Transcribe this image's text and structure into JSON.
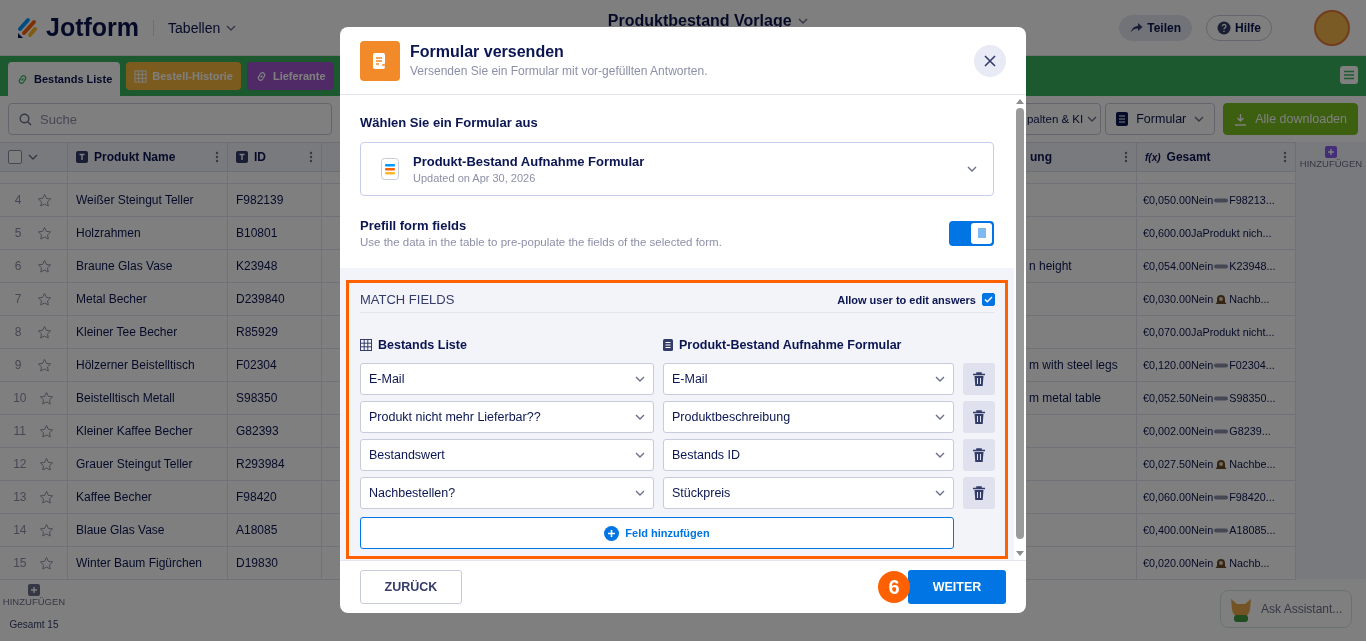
{
  "header": {
    "logo": "Jotform",
    "app_menu": "Tabellen",
    "title": "Produktbestand Vorlage",
    "buttons": [
      {
        "label": "Teilen",
        "kind": "share"
      },
      {
        "label": "Hilfe",
        "kind": "help"
      }
    ]
  },
  "tabs": [
    {
      "label": "Bestands Liste",
      "kind": "link",
      "selected": true
    },
    {
      "label": "Bestell-Historie",
      "kind": "grid",
      "selected": false
    },
    {
      "label": "Lieferante",
      "kind": "link",
      "selected": false
    }
  ],
  "toolbar": {
    "search": {
      "placeholder": "Suche"
    },
    "buttons": [
      {
        "label": "palten & KI",
        "kind": "dropdown"
      },
      {
        "label": "Formular",
        "kind": "form"
      },
      {
        "label": "Alle downloaden",
        "kind": "download"
      }
    ]
  },
  "table": {
    "select_all": {
      "checked": false
    },
    "columns": [
      {
        "label": "Produkt Name",
        "kind": "text"
      },
      {
        "label": "ID",
        "kind": "text"
      },
      {
        "label": "ung",
        "kind": "plain"
      },
      {
        "label": "Gesamt",
        "kind": "formula",
        "symbol": "f(x)"
      }
    ],
    "add_column": "HINZUFÜGEN",
    "rows": [
      {
        "number": "4",
        "starred": false,
        "name": "Weißer Steingut Teller",
        "id": "F982139",
        "gesamt": {
          "value": "€0,050.00Nein",
          "kind": "dash",
          "rest": "F98213..."
        }
      },
      {
        "number": "5",
        "starred": false,
        "name": "Holzrahmen",
        "id": "B10801",
        "gesamt": {
          "value": "€0,600.00JaProdukt nich..."
        }
      },
      {
        "number": "6",
        "starred": false,
        "name": "Braune Glas Vase",
        "id": "K23948",
        "column_3": "n height",
        "gesamt": {
          "value": "€0,054.00Nein",
          "kind": "dash",
          "rest": "K23948..."
        }
      },
      {
        "number": "7",
        "starred": false,
        "name": "Metal Becher",
        "id": "D239840",
        "gesamt": {
          "value": "€0,030.00Nein",
          "kind": "alert",
          "rest": "Nachb..."
        }
      },
      {
        "number": "8",
        "starred": false,
        "name": "Kleiner Tee Becher",
        "id": "R85929",
        "gesamt": {
          "value": "€0,070.00JaProdukt nicht..."
        }
      },
      {
        "number": "9",
        "starred": false,
        "name": "Hölzerner Beistelltisch",
        "id": "F02304",
        "column_3": "m with steel legs",
        "gesamt": {
          "value": "€0,120.00Nein",
          "kind": "dash",
          "rest": "F02304..."
        }
      },
      {
        "number": "10",
        "starred": false,
        "name": "Beistelltisch Metall",
        "id": "S98350",
        "column_3": "m metal table",
        "gesamt": {
          "value": "€0,052.50Nein",
          "kind": "dash",
          "rest": "S98350..."
        }
      },
      {
        "number": "11",
        "starred": false,
        "name": "Kleiner Kaffee Becher",
        "id": "G82393",
        "gesamt": {
          "value": "€0,002.00Nein",
          "kind": "dash",
          "rest": "G8239..."
        }
      },
      {
        "number": "12",
        "starred": false,
        "name": "Grauer Steingut Teller",
        "id": "R293984",
        "gesamt": {
          "value": "€0,027.50Nein",
          "kind": "alert",
          "rest": "Nachbe..."
        }
      },
      {
        "number": "13",
        "starred": false,
        "name": "Kaffee Becher",
        "id": "F98420",
        "gesamt": {
          "value": "€0,060.00Nein",
          "kind": "dash",
          "rest": "F98420..."
        }
      },
      {
        "number": "14",
        "starred": false,
        "name": "Blaue Glas Vase",
        "id": "A18085",
        "gesamt": {
          "value": "€0,400.00Nein",
          "kind": "dash",
          "rest": "A18085..."
        }
      },
      {
        "number": "15",
        "starred": false,
        "name": "Winter Baum Figürchen",
        "id": "D19830",
        "gesamt": {
          "value": "€0,020.00Nein",
          "kind": "alert",
          "rest": "Nachb..."
        }
      }
    ],
    "add_row": "HINZUFÜGEN",
    "total": "Gesamt 15"
  },
  "assistant": {
    "label": "Ask Assistant..."
  },
  "modal": {
    "title": "Formular versenden",
    "subtitle": "Versenden Sie ein Formular mit vor-gefüllten Antworten.",
    "form_select": {
      "label": "Wählen Sie ein Formular aus",
      "name": "Produkt-Bestand Aufnahme Formular",
      "updated": "Updated on Apr 30, 2026"
    },
    "prefill": {
      "title": "Prefill form fields",
      "description": "Use the data in the table to pre-populate the fields of the selected form.",
      "on": true
    },
    "match_fields": {
      "title": "MATCH FIELDS",
      "allow_edit": {
        "label": "Allow user to edit answers",
        "checked": true
      },
      "source": "Bestands Liste",
      "target": "Produkt-Bestand Aufnahme Formular",
      "pairs": [
        {
          "source": "E-Mail",
          "target": "E-Mail"
        },
        {
          "source": "Produkt nicht mehr Lieferbar??",
          "target": "Produktbeschreibung"
        },
        {
          "source": "Bestandswert",
          "target": "Bestands ID"
        },
        {
          "source": "Nachbestellen?",
          "target": "Stückpreis"
        }
      ],
      "add_button": "Feld hinzufügen"
    },
    "back_button": "ZURÜCK",
    "step": "6",
    "next_button": "WEITER"
  }
}
